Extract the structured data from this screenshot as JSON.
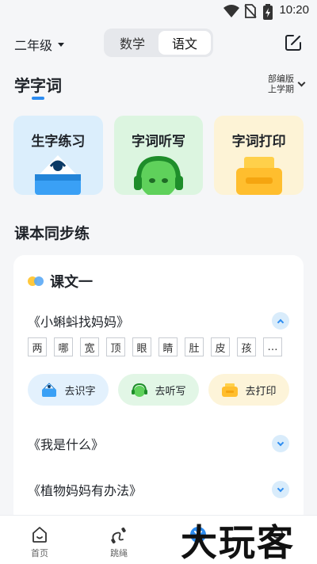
{
  "status": {
    "time": "10:20"
  },
  "header": {
    "grade": "二年级",
    "subjects": [
      {
        "label": "数学",
        "active": false
      },
      {
        "label": "语文",
        "active": true
      }
    ]
  },
  "section": {
    "title": "学字词",
    "edition_line1": "部编版",
    "edition_line2": "上学期"
  },
  "tools": [
    {
      "label": "生字练习",
      "color": "#dbeefc"
    },
    {
      "label": "字词听写",
      "color": "#dcf5e0"
    },
    {
      "label": "字词打印",
      "color": "#fdf3d6"
    }
  ],
  "sync": {
    "title": "课本同步练"
  },
  "lesson": {
    "name": "课文一",
    "texts": [
      {
        "title": "《小蝌蚪找妈妈》",
        "expanded": true
      },
      {
        "title": "《我是什么》",
        "expanded": false
      },
      {
        "title": "《植物妈妈有办法》",
        "expanded": false
      }
    ],
    "chars": [
      "两",
      "哪",
      "宽",
      "顶",
      "眼",
      "睛",
      "肚",
      "皮",
      "孩",
      "…"
    ],
    "actions": [
      {
        "label": "去识字",
        "color": "#e3f1fd"
      },
      {
        "label": "去听写",
        "color": "#e2f6e6"
      },
      {
        "label": "去打印",
        "color": "#fdf4d9"
      }
    ]
  },
  "tabbar": {
    "items": [
      {
        "label": "首页",
        "icon": "home-icon"
      },
      {
        "label": "跳绳",
        "icon": "jump-rope-icon"
      },
      {
        "label": "",
        "icon": "center-icon"
      },
      {
        "label": "",
        "icon": "profile-icon"
      }
    ]
  },
  "watermark": "大玩客",
  "colors": {
    "accent": "#2d8cf0",
    "background": "#f5f6f8"
  }
}
